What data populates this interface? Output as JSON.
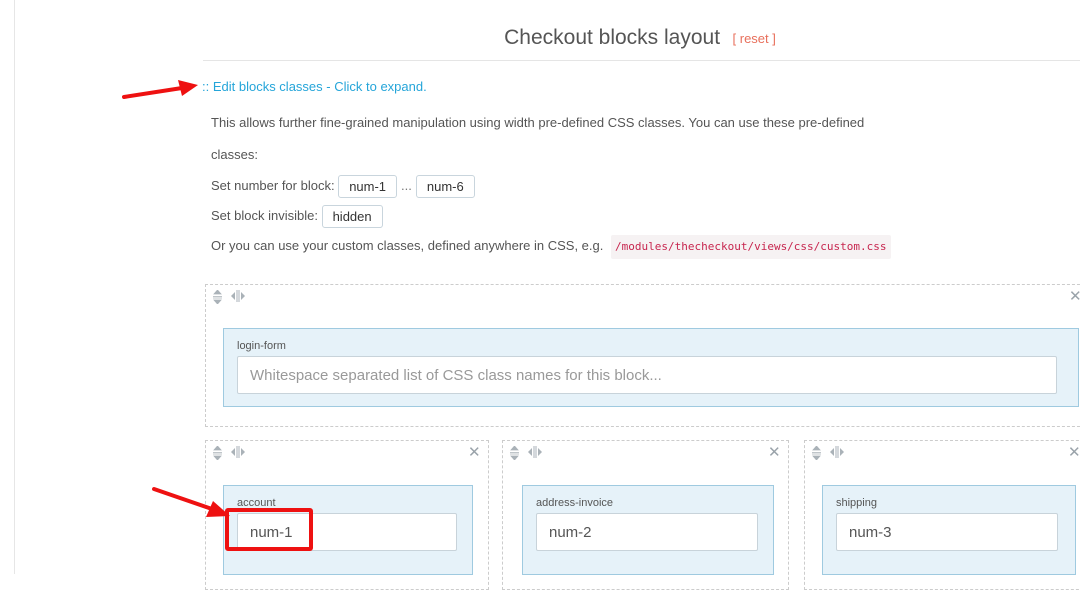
{
  "header": {
    "title": "Checkout blocks layout",
    "reset_label": "[ reset ]"
  },
  "expand_link": ":: Edit blocks classes - Click to expand.",
  "help": {
    "line1": "This allows further fine-grained manipulation using width pre-defined CSS classes. You can use these pre-defined",
    "line2": "classes:",
    "number_label": "Set number for block:",
    "num_first": "num-1",
    "ellipsis": "...",
    "num_last": "num-6",
    "invisible_label": "Set block invisible:",
    "hidden_class": "hidden",
    "custom_text": "Or you can use your custom classes, defined anywhere in CSS, e.g.",
    "custom_path": "/modules/thecheckout/views/css/custom.css"
  },
  "icons": {
    "move_vertical": "up-down-arrows-icon",
    "resize": "horizontal-resize-icon",
    "close": "close-x-icon",
    "annotation": "red-arrow-icon"
  },
  "blocks": {
    "login": {
      "label": "login-form",
      "value": "",
      "placeholder": "Whitespace separated list of CSS class names for this block..."
    },
    "account": {
      "label": "account",
      "value": "num-1"
    },
    "address": {
      "label": "address-invoice",
      "value": "num-2"
    },
    "shipping": {
      "label": "shipping",
      "value": "num-3"
    }
  },
  "colors": {
    "link": "#25a5d9",
    "reset": "#e8705c",
    "block_bg": "#e6f2f9",
    "block_border": "#9fcae0",
    "annotation_red": "#ee1111"
  }
}
